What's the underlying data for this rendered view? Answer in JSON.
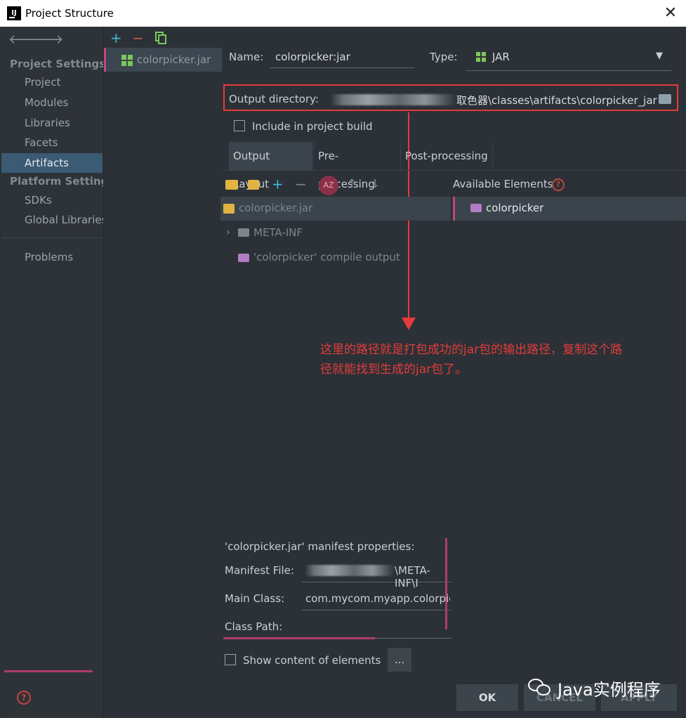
{
  "window": {
    "title": "Project Structure",
    "app_icon": "IJ"
  },
  "sidebar": {
    "project_settings_header": "Project Settings",
    "items": [
      {
        "label": "Project"
      },
      {
        "label": "Modules"
      },
      {
        "label": "Libraries"
      },
      {
        "label": "Facets"
      },
      {
        "label": "Artifacts",
        "selected": true
      }
    ],
    "platform_settings_header": "Platform Settings",
    "platform_items": [
      {
        "label": "SDKs"
      },
      {
        "label": "Global Libraries"
      }
    ],
    "problems_label": "Problems"
  },
  "artifacts_list": {
    "items": [
      "colorpicker.jar"
    ]
  },
  "form": {
    "name_label": "Name:",
    "name_value": "colorpicker:jar",
    "type_label": "Type:",
    "type_value": "JAR",
    "output_dir_label": "Output directory:",
    "output_dir_value": "取色器\\classes\\artifacts\\colorpicker_jar",
    "include_label": "Include in project build"
  },
  "tabs": [
    {
      "label": "Output Layout",
      "selected": true
    },
    {
      "label": "Pre-processing"
    },
    {
      "label": "Post-processing"
    }
  ],
  "toolbar": {
    "available_label": "Available Elements"
  },
  "tree": {
    "root": "colorpicker.jar",
    "children": [
      {
        "label": "META-INF"
      },
      {
        "label": "'colorpicker' compile output"
      }
    ]
  },
  "available": {
    "items": [
      "colorpicker"
    ]
  },
  "annotation": {
    "line1": "这里的路径就是打包成功的jar包的输出路径，复制这个路",
    "line2": "径就能找到生成的jar包了。"
  },
  "manifest": {
    "header": "'colorpicker.jar' manifest properties:",
    "file_label": "Manifest File:",
    "file_value": "\\META-INF\\I",
    "main_class_label": "Main Class:",
    "main_class_value": "com.mycom.myapp.colorpic",
    "class_path_label": "Class Path:"
  },
  "show_content_label": "Show content of elements",
  "ellipsis_label": "...",
  "buttons": {
    "ok": "OK",
    "cancel": "CANCEL",
    "apply": "APPLY"
  },
  "watermark": "Java实例程序",
  "colors": {
    "accent_red": "#e53b3b",
    "selection": "#3b5a73",
    "jar_green": "#7cc75a",
    "pink": "#c04a7e"
  }
}
